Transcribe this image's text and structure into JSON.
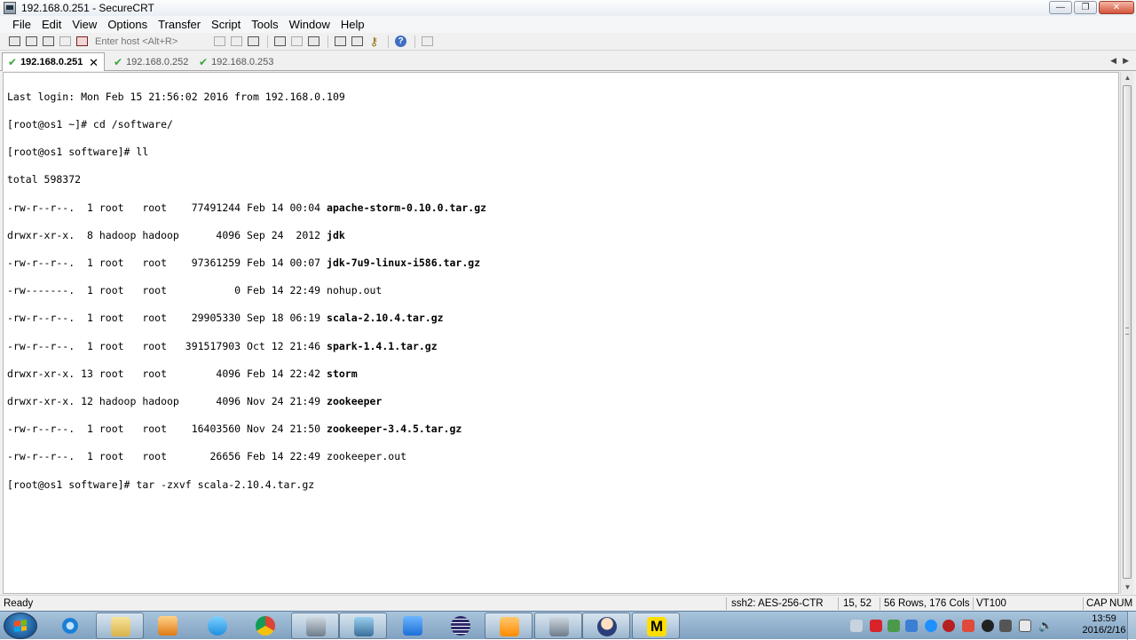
{
  "window": {
    "title": "192.168.0.251 - SecureCRT",
    "controls": {
      "minimize": "—",
      "maximize": "❐",
      "close": "✕"
    }
  },
  "menu": [
    "File",
    "Edit",
    "View",
    "Options",
    "Transfer",
    "Script",
    "Tools",
    "Window",
    "Help"
  ],
  "toolbar": {
    "host_placeholder": "Enter host <Alt+R>",
    "help_glyph": "?",
    "key_glyph": "⚷"
  },
  "tabs": [
    {
      "label": "192.168.0.251",
      "active": true,
      "close": "✕"
    },
    {
      "label": "192.168.0.252",
      "active": false
    },
    {
      "label": "192.168.0.253",
      "active": false
    }
  ],
  "tab_scroll": {
    "left": "◀",
    "right": "▶"
  },
  "terminal": {
    "lines": [
      {
        "text": "Last login: Mon Feb 15 21:56:02 2016 from 192.168.0.109"
      },
      {
        "text": "[root@os1 ~]# cd /software/"
      },
      {
        "text": "[root@os1 software]# ll"
      },
      {
        "text": "total 598372"
      },
      {
        "text": "-rw-r--r--.  1 root   root    77491244 Feb 14 00:04 ",
        "file": "apache-storm-0.10.0.tar.gz",
        "bold": true
      },
      {
        "text": "drwxr-xr-x.  8 hadoop hadoop      4096 Sep 24  2012 ",
        "file": "jdk",
        "bold": true
      },
      {
        "text": "-rw-r--r--.  1 root   root    97361259 Feb 14 00:07 ",
        "file": "jdk-7u9-linux-i586.tar.gz",
        "bold": true
      },
      {
        "text": "-rw-------.  1 root   root           0 Feb 14 22:49 ",
        "file": "nohup.out",
        "bold": false
      },
      {
        "text": "-rw-r--r--.  1 root   root    29905330 Sep 18 06:19 ",
        "file": "scala-2.10.4.tar.gz",
        "bold": true
      },
      {
        "text": "-rw-r--r--.  1 root   root   391517903 Oct 12 21:46 ",
        "file": "spark-1.4.1.tar.gz",
        "bold": true
      },
      {
        "text": "drwxr-xr-x. 13 root   root        4096 Feb 14 22:42 ",
        "file": "storm",
        "bold": true
      },
      {
        "text": "drwxr-xr-x. 12 hadoop hadoop      4096 Nov 24 21:49 ",
        "file": "zookeeper",
        "bold": true
      },
      {
        "text": "-rw-r--r--.  1 root   root    16403560 Nov 24 21:50 ",
        "file": "zookeeper-3.4.5.tar.gz",
        "bold": true
      },
      {
        "text": "-rw-r--r--.  1 root   root       26656 Feb 14 22:49 ",
        "file": "zookeeper.out",
        "bold": false
      },
      {
        "text": "[root@os1 software]# tar -zxvf scala-2.10.4.tar.gz"
      }
    ]
  },
  "statusbar": {
    "ready": "Ready",
    "cipher": "ssh2: AES-256-CTR",
    "cursor": "15,  52",
    "size": "56 Rows, 176 Cols",
    "emulation": "VT100",
    "cap": "CAP",
    "num": "NUM"
  },
  "taskbar": {
    "clock_time": "13:59",
    "clock_date": "2016/2/16"
  }
}
